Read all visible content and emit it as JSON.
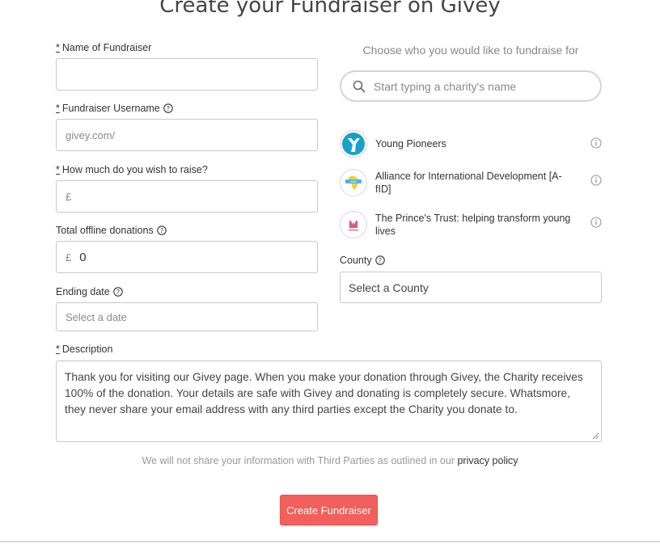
{
  "page": {
    "title": "Create your Fundraiser on Givey"
  },
  "form": {
    "required_mark": "*",
    "name": {
      "label": "Name of Fundraiser",
      "value": ""
    },
    "username": {
      "label": "Fundraiser Username",
      "placeholder": "givey.com/"
    },
    "target": {
      "label": "How much do you wish to raise?",
      "currency": "£",
      "value": ""
    },
    "offline": {
      "label": "Total offline donations",
      "currency": "£",
      "value": "0"
    },
    "ending_date": {
      "label": "Ending date",
      "placeholder": "Select a date"
    },
    "description": {
      "label": "Description",
      "value": "Thank you for visiting our Givey page. When you make your donation through Givey, the Charity receives 100% of the donation. Your details are safe with Givey and donating is completely secure. Whatsmore, they never share your email address with any third parties except the Charity you donate to."
    }
  },
  "charity": {
    "heading": "Choose who you would like to fundraise for",
    "search_placeholder": "Start typing a charity's name",
    "items": [
      {
        "name": "Young Pioneers",
        "logo": "young-pioneers-logo"
      },
      {
        "name": "Alliance for International Development [A-fID]",
        "logo": "afid-logo"
      },
      {
        "name": "The Prince's Trust: helping transform young lives",
        "logo": "princes-trust-logo"
      }
    ],
    "county": {
      "label": "County",
      "selected": "Select a County"
    }
  },
  "footer": {
    "notice": "We will not share your information with Third Parties as outlined in our",
    "privacy_link": "privacy policy",
    "submit_label": "Create Fundraiser"
  },
  "colors": {
    "accent": "#f25f5c",
    "border": "#c8c8c8",
    "muted_text": "#888888"
  }
}
